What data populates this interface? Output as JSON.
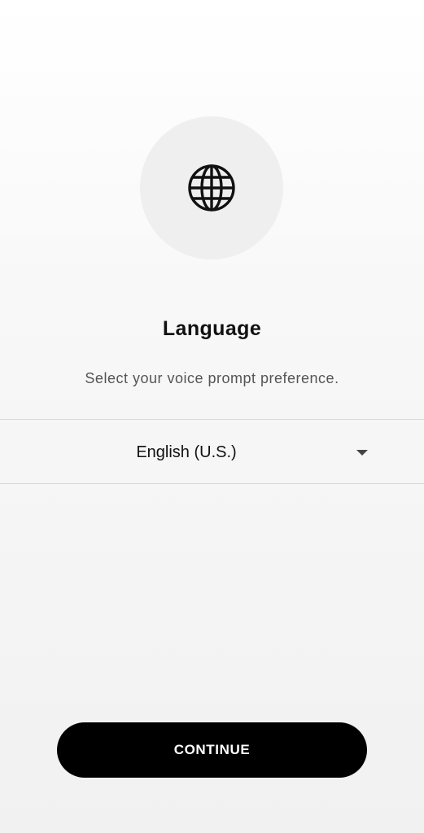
{
  "header": {
    "icon": "globe-icon",
    "title": "Language",
    "subtitle": "Select your voice prompt preference."
  },
  "language_select": {
    "selected_value": "English (U.S.)",
    "caret_icon": "caret-down-icon"
  },
  "footer": {
    "continue_label": "CONTINUE"
  },
  "colors": {
    "button_background": "#000000",
    "button_text": "#ffffff",
    "icon_circle": "#efefef"
  }
}
